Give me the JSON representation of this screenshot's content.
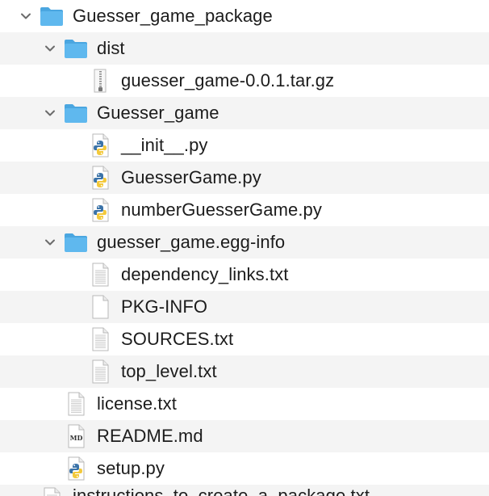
{
  "window": {
    "title": "Guesser_game_package"
  },
  "tree": [
    {
      "label": "Guesser_game_package",
      "kind": "folder",
      "depth": 0,
      "expanded": true
    },
    {
      "label": "dist",
      "kind": "folder",
      "depth": 1,
      "expanded": true
    },
    {
      "label": "guesser_game-0.0.1.tar.gz",
      "kind": "archive",
      "depth": 2
    },
    {
      "label": "Guesser_game",
      "kind": "folder",
      "depth": 1,
      "expanded": true
    },
    {
      "label": "__init__.py",
      "kind": "python",
      "depth": 2
    },
    {
      "label": "GuesserGame.py",
      "kind": "python",
      "depth": 2
    },
    {
      "label": "numberGuesserGame.py",
      "kind": "python",
      "depth": 2
    },
    {
      "label": "guesser_game.egg-info",
      "kind": "folder",
      "depth": 1,
      "expanded": true
    },
    {
      "label": "dependency_links.txt",
      "kind": "text",
      "depth": 2
    },
    {
      "label": "PKG-INFO",
      "kind": "blank",
      "depth": 2
    },
    {
      "label": "SOURCES.txt",
      "kind": "text",
      "depth": 2
    },
    {
      "label": "top_level.txt",
      "kind": "text",
      "depth": 2
    },
    {
      "label": "license.txt",
      "kind": "text",
      "depth": 1
    },
    {
      "label": "README.md",
      "kind": "markdown",
      "depth": 1
    },
    {
      "label": "setup.py",
      "kind": "python",
      "depth": 1
    },
    {
      "label": "instructions_to_create_a_package.txt",
      "kind": "text",
      "depth": 0,
      "partial": true
    }
  ],
  "colors": {
    "folder": "#5fb8ee",
    "folder_tab": "#4aa6e0",
    "row_alt": "#f4f4f4",
    "python_blue": "#3b73a8",
    "python_yellow": "#f3c93c",
    "chevron": "#6b6b6b"
  },
  "icons": {
    "folder": "folder-icon",
    "archive": "archive-icon",
    "python": "python-file-icon",
    "text": "text-file-icon",
    "blank": "blank-file-icon",
    "markdown": "markdown-file-icon",
    "chevron": "chevron-down-icon"
  }
}
